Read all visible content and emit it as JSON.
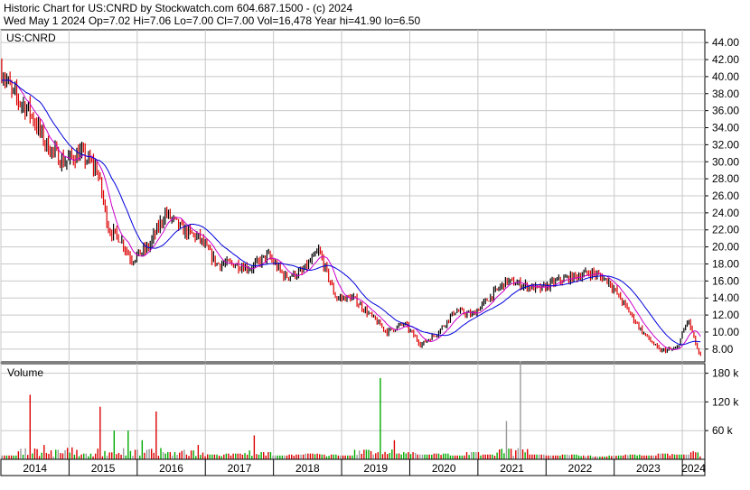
{
  "header": {
    "title": "Historic Chart for US:CNRD by Stockwatch.com 604.687.1500 - (c) 2024",
    "quote": "Wed May  1 2024   Op=7.02  Hi=7.06  Lo=7.00  Cl=7.00  Vol=16,478  Year hi=41.90  lo=6.50"
  },
  "colors": {
    "up_bar": "#000000",
    "down_bar": "#dd0000",
    "ma_short": "#cc00cc",
    "ma_long": "#0000dd",
    "volume_down": "#dd0000",
    "volume_up": "#00aa00",
    "volume_flat": "#999999",
    "grid": "#c8c8c8"
  },
  "chart_data": [
    {
      "type": "line",
      "label": "US:CNRD",
      "ylim": [
        6.5,
        45.5
      ],
      "yticks": [
        "44.00",
        "42.00",
        "40.00",
        "38.00",
        "36.00",
        "34.00",
        "32.00",
        "30.00",
        "28.00",
        "26.00",
        "24.00",
        "22.00",
        "20.00",
        "18.00",
        "16.00",
        "14.00",
        "12.00",
        "10.00",
        "8.00"
      ],
      "ytick_values": [
        44,
        42,
        40,
        38,
        36,
        34,
        32,
        30,
        28,
        26,
        24,
        22,
        20,
        18,
        16,
        14,
        12,
        10,
        8
      ],
      "x": [
        "2014-01",
        "2014-03",
        "2014-06",
        "2014-09",
        "2014-12",
        "2015-03",
        "2015-06",
        "2015-08",
        "2015-10",
        "2015-12",
        "2016-03",
        "2016-06",
        "2016-09",
        "2016-12",
        "2017-03",
        "2017-06",
        "2017-09",
        "2017-12",
        "2018-03",
        "2018-06",
        "2018-09",
        "2018-12",
        "2019-03",
        "2019-06",
        "2019-09",
        "2019-12",
        "2020-03",
        "2020-06",
        "2020-09",
        "2020-12",
        "2021-03",
        "2021-06",
        "2021-09",
        "2021-12",
        "2022-03",
        "2022-06",
        "2022-09",
        "2022-12",
        "2023-03",
        "2023-06",
        "2023-09",
        "2023-12",
        "2024-02",
        "2024-04"
      ],
      "close": [
        41,
        38,
        36,
        32,
        30,
        31,
        29,
        22,
        21,
        18.5,
        20,
        24,
        22,
        21,
        18,
        18,
        17.5,
        19,
        16.5,
        17,
        19.5,
        14,
        14,
        12,
        10,
        11,
        8.5,
        10,
        12.5,
        12,
        14,
        16,
        15.5,
        15,
        16,
        16.5,
        17,
        16,
        13,
        10,
        7.8,
        8,
        11.5,
        7.2
      ],
      "series": [
        {
          "name": "",
          "values_key": "close"
        }
      ]
    },
    {
      "type": "bar",
      "label": "Volume",
      "ylim": [
        0,
        200
      ],
      "yticks": [
        "180 k",
        "120 k",
        "60 k"
      ],
      "ytick_values": [
        180,
        120,
        60
      ],
      "xticks": [
        "2014",
        "2015",
        "2016",
        "2017",
        "2018",
        "2019",
        "2020",
        "2021",
        "2022",
        "2023",
        "2024"
      ],
      "volume_k": [
        8,
        135,
        30,
        20,
        25,
        12,
        110,
        60,
        40,
        100,
        15,
        20,
        30,
        10,
        12,
        50,
        15,
        8,
        10,
        12,
        10,
        8,
        20,
        170,
        40,
        15,
        10,
        12,
        8,
        15,
        10,
        80,
        205,
        10,
        8,
        10,
        8,
        6,
        8,
        10,
        8,
        12,
        10,
        25
      ]
    }
  ]
}
